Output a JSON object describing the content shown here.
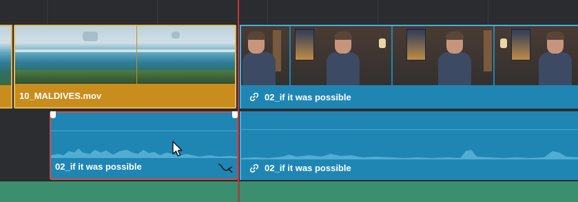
{
  "timeline": {
    "video_clips": [
      {
        "name": "10_MALDIVES.mov",
        "linked": false
      },
      {
        "name": "02_if it was possible",
        "linked": true
      }
    ],
    "audio_clips": [
      {
        "name": "02_if it was possible",
        "linked": false,
        "selected": true
      },
      {
        "name": "02_if it was possible",
        "linked": true,
        "selected": false
      }
    ]
  },
  "colors": {
    "video_clip_orange": "#c98d1e",
    "clip_blue": "#1f86b4",
    "selection_red": "#d84a4a",
    "playhead_red": "#c03a3a",
    "green_track": "#3b8f6e",
    "background": "#28292c"
  },
  "icons": {
    "link": "link-icon",
    "fade": "fade-curve-icon",
    "cursor": "mouse-pointer-icon"
  }
}
